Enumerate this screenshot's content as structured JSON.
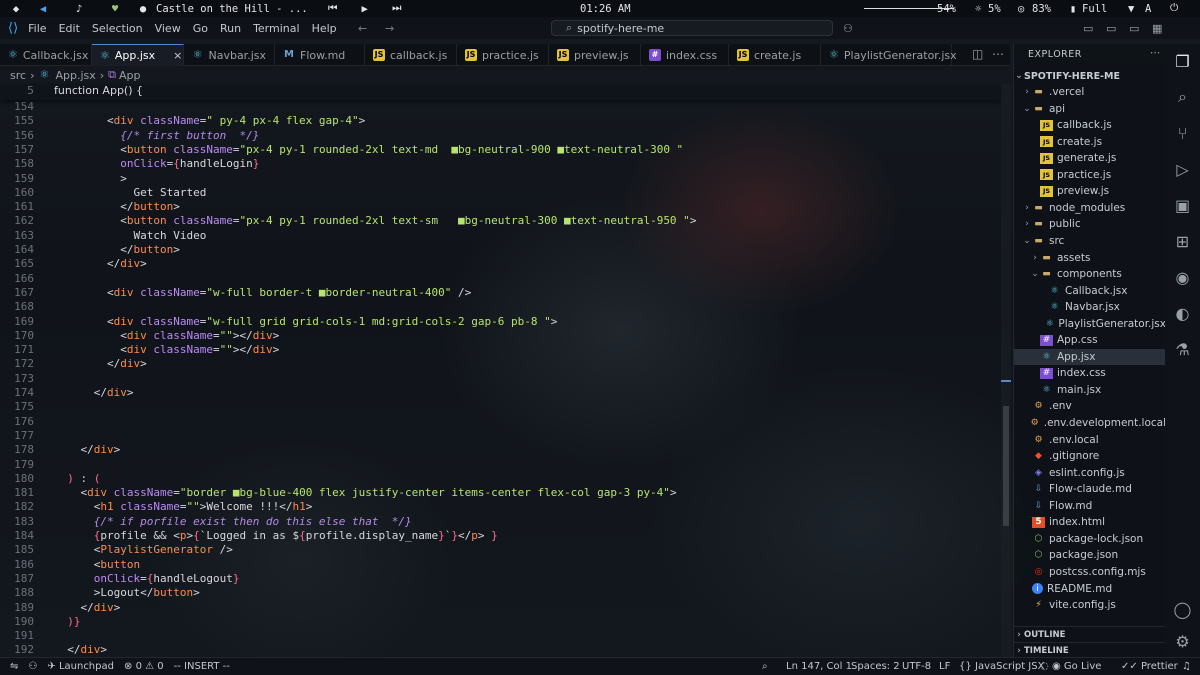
{
  "system_bar": {
    "media_title": "Castle on the Hill - ...",
    "clock": "01:26 AM",
    "volume": "54%",
    "brightness": "5%",
    "cpu": "83%",
    "battery": "Full",
    "wifi": "A"
  },
  "titlebar": {
    "menu": [
      "File",
      "Edit",
      "Selection",
      "View",
      "Go",
      "Run",
      "Terminal",
      "Help"
    ],
    "search": "spotify-here-me"
  },
  "tabs": [
    {
      "label": "Callback.jsx",
      "type": "jsx"
    },
    {
      "label": "App.jsx",
      "type": "jsx",
      "active": true
    },
    {
      "label": "Navbar.jsx",
      "type": "jsx"
    },
    {
      "label": "Flow.md",
      "type": "md"
    },
    {
      "label": "callback.js",
      "type": "js"
    },
    {
      "label": "practice.js",
      "type": "js"
    },
    {
      "label": "preview.js",
      "type": "js"
    },
    {
      "label": "index.css",
      "type": "css"
    },
    {
      "label": "create.js",
      "type": "js"
    },
    {
      "label": "PlaylistGenerator.jsx",
      "type": "jsx"
    }
  ],
  "breadcrumb": {
    "folder": "src",
    "file": "App.jsx",
    "symbol": "App"
  },
  "sticky": {
    "line": "5",
    "code": "function App() {"
  },
  "code_lines": [
    {
      "n": "154",
      "t": ""
    },
    {
      "n": "155",
      "t": "        <div className=\" py-4 px-4 flex gap-4\">"
    },
    {
      "n": "156",
      "t": "          {/* first button  */}"
    },
    {
      "n": "157",
      "t": "          <button className=\"px-4 py-1 rounded-2xl text-md  ■bg-neutral-900 ■text-neutral-300 \""
    },
    {
      "n": "158",
      "t": "          onClick={handleLogin}"
    },
    {
      "n": "159",
      "t": "          >"
    },
    {
      "n": "160",
      "t": "            Get Started"
    },
    {
      "n": "161",
      "t": "          </button>"
    },
    {
      "n": "162",
      "t": "          <button className=\"px-4 py-1 rounded-2xl text-sm   ■bg-neutral-300 ■text-neutral-950 \">"
    },
    {
      "n": "163",
      "t": "            Watch Video"
    },
    {
      "n": "164",
      "t": "          </button>"
    },
    {
      "n": "165",
      "t": "        </div>"
    },
    {
      "n": "166",
      "t": ""
    },
    {
      "n": "167",
      "t": "        <div className=\"w-full border-t ■border-neutral-400\" />"
    },
    {
      "n": "168",
      "t": ""
    },
    {
      "n": "169",
      "t": "        <div className=\"w-full grid grid-cols-1 md:grid-cols-2 gap-6 pb-8 \">"
    },
    {
      "n": "170",
      "t": "          <div className=\"\"></div>"
    },
    {
      "n": "171",
      "t": "          <div className=\"\"></div>"
    },
    {
      "n": "172",
      "t": "        </div>"
    },
    {
      "n": "173",
      "t": ""
    },
    {
      "n": "174",
      "t": "      </div>"
    },
    {
      "n": "175",
      "t": ""
    },
    {
      "n": "176",
      "t": ""
    },
    {
      "n": "177",
      "t": ""
    },
    {
      "n": "178",
      "t": "    </div>"
    },
    {
      "n": "179",
      "t": ""
    },
    {
      "n": "180",
      "t": "  ) : ("
    },
    {
      "n": "181",
      "t": "    <div className=\"border ■bg-blue-400 flex justify-center items-center flex-col gap-3 py-4\">"
    },
    {
      "n": "182",
      "t": "      <h1 className=\"\">Welcome !!!</h1>"
    },
    {
      "n": "183",
      "t": "      {/* if porfile exist then do this else that  */}"
    },
    {
      "n": "184",
      "t": "      {profile && <p>{`Logged in as ${profile.display_name}`}</p> }"
    },
    {
      "n": "185",
      "t": "      <PlaylistGenerator />"
    },
    {
      "n": "186",
      "t": "      <button"
    },
    {
      "n": "187",
      "t": "      onClick={handleLogout}"
    },
    {
      "n": "188",
      "t": "      >Logout</button>"
    },
    {
      "n": "189",
      "t": "    </div>"
    },
    {
      "n": "190",
      "t": "  )}"
    },
    {
      "n": "191",
      "t": ""
    },
    {
      "n": "192",
      "t": "  </div>"
    }
  ],
  "explorer": {
    "title": "EXPLORER",
    "root": "SPOTIFY-HERE-ME",
    "items": [
      {
        "label": ".vercel",
        "depth": 1,
        "kind": "folder",
        "open": false
      },
      {
        "label": "api",
        "depth": 1,
        "kind": "folder",
        "open": true
      },
      {
        "label": "callback.js",
        "depth": 2,
        "kind": "js"
      },
      {
        "label": "create.js",
        "depth": 2,
        "kind": "js"
      },
      {
        "label": "generate.js",
        "depth": 2,
        "kind": "js"
      },
      {
        "label": "practice.js",
        "depth": 2,
        "kind": "js"
      },
      {
        "label": "preview.js",
        "depth": 2,
        "kind": "js"
      },
      {
        "label": "node_modules",
        "depth": 1,
        "kind": "folder",
        "open": false
      },
      {
        "label": "public",
        "depth": 1,
        "kind": "folder",
        "open": false
      },
      {
        "label": "src",
        "depth": 1,
        "kind": "folder",
        "open": true
      },
      {
        "label": "assets",
        "depth": 2,
        "kind": "folder",
        "open": false
      },
      {
        "label": "components",
        "depth": 2,
        "kind": "folder",
        "open": true
      },
      {
        "label": "Callback.jsx",
        "depth": 3,
        "kind": "jsx"
      },
      {
        "label": "Navbar.jsx",
        "depth": 3,
        "kind": "jsx"
      },
      {
        "label": "PlaylistGenerator.jsx",
        "depth": 3,
        "kind": "jsx"
      },
      {
        "label": "App.css",
        "depth": 2,
        "kind": "css"
      },
      {
        "label": "App.jsx",
        "depth": 2,
        "kind": "jsx",
        "selected": true
      },
      {
        "label": "index.css",
        "depth": 2,
        "kind": "css"
      },
      {
        "label": "main.jsx",
        "depth": 2,
        "kind": "jsx"
      },
      {
        "label": ".env",
        "depth": 1,
        "kind": "env"
      },
      {
        "label": ".env.development.local",
        "depth": 1,
        "kind": "env"
      },
      {
        "label": ".env.local",
        "depth": 1,
        "kind": "env"
      },
      {
        "label": ".gitignore",
        "depth": 1,
        "kind": "git"
      },
      {
        "label": "eslint.config.js",
        "depth": 1,
        "kind": "eslint"
      },
      {
        "label": "Flow-claude.md",
        "depth": 1,
        "kind": "md"
      },
      {
        "label": "Flow.md",
        "depth": 1,
        "kind": "md"
      },
      {
        "label": "index.html",
        "depth": 1,
        "kind": "html"
      },
      {
        "label": "package-lock.json",
        "depth": 1,
        "kind": "json"
      },
      {
        "label": "package.json",
        "depth": 1,
        "kind": "json"
      },
      {
        "label": "postcss.config.mjs",
        "depth": 1,
        "kind": "postcss"
      },
      {
        "label": "README.md",
        "depth": 1,
        "kind": "info"
      },
      {
        "label": "vite.config.js",
        "depth": 1,
        "kind": "vite"
      }
    ],
    "outline": "OUTLINE",
    "timeline": "TIMELINE"
  },
  "statusbar": {
    "launchpad": "Launchpad",
    "errors": "0",
    "warnings": "0",
    "mode": "-- INSERT --",
    "position": "Ln 147, Col 1",
    "spaces": "Spaces: 2",
    "encoding": "UTF-8",
    "eol": "LF",
    "language": "JavaScript JSX",
    "golive": "Go Live",
    "prettier": "Prettier"
  }
}
